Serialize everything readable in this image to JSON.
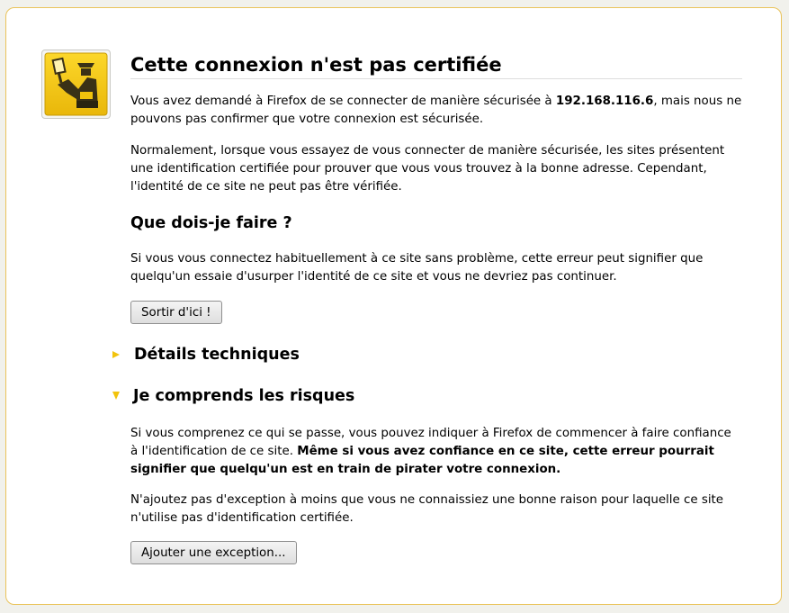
{
  "title": "Cette connexion n'est pas certifiée",
  "intro": {
    "before": "Vous avez demandé à Firefox de se connecter de manière sécurisée à ",
    "host": "192.168.116.6",
    "after": ", mais nous ne pouvons pas confirmer que votre connexion est sécurisée."
  },
  "explanation": "Normalement, lorsque vous essayez de vous connecter de manière sécurisée, les sites présentent une identification certifiée pour prouver que vous vous trouvez à la bonne adresse. Cependant, l'identité de ce site ne peut pas être vérifiée.",
  "what_to_do": {
    "heading": "Que dois-je faire ?",
    "text": "Si vous vous connectez habituellement à ce site sans problème, cette erreur peut signifier que quelqu'un essaie d'usurper l'identité de ce site et vous ne devriez pas continuer.",
    "button": "Sortir d'ici !"
  },
  "technical": {
    "heading": "Détails techniques",
    "expanded": false
  },
  "risks": {
    "heading": "Je comprends les risques",
    "expanded": true,
    "text_plain": "Si vous comprenez ce qui se passe, vous pouvez indiquer à Firefox de commencer à faire confiance à l'identification de ce site. ",
    "text_bold": "Même si vous avez confiance en ce site, cette erreur pourrait signifier que quelqu'un est en train de pirater votre connexion.",
    "advice": "N'ajoutez pas d'exception à moins que vous ne connaissiez une bonne raison pour laquelle ce site n'utilise pas d'identification certifiée.",
    "button": "Ajouter une exception..."
  },
  "icons": {
    "header": "policeman-id-icon",
    "collapsed": "triangle-right-icon",
    "expanded": "triangle-down-icon"
  },
  "colors": {
    "accent": "#f2c30c",
    "border": "#eac35a",
    "icon_background": "#f7ce1c",
    "icon_figure": "#3a3116"
  }
}
